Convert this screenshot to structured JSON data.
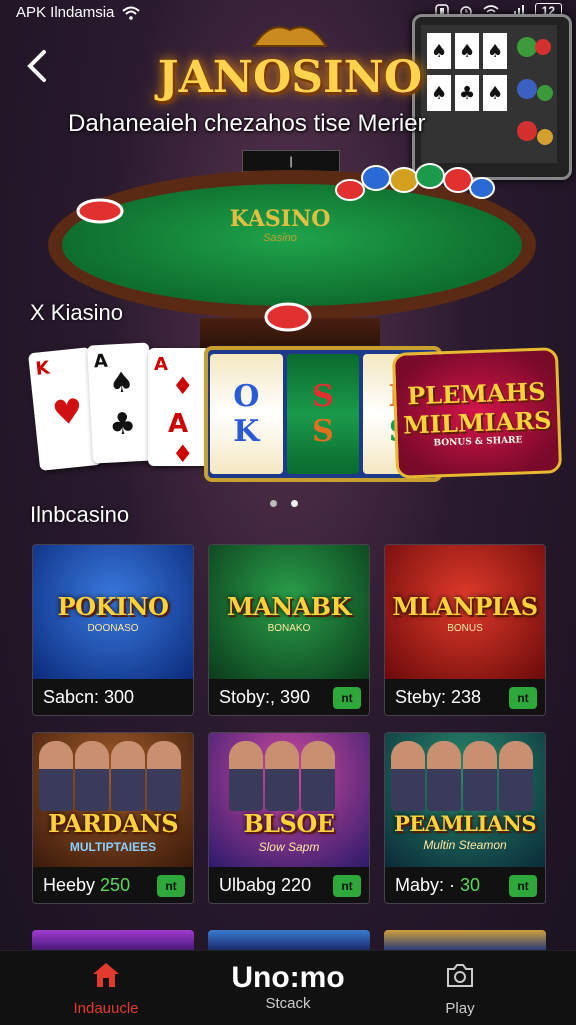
{
  "status_bar": {
    "carrier": "APK Ilndamsia",
    "battery": "12",
    "icons": [
      "wifi-icon",
      "alarm-icon",
      "signal-icon"
    ]
  },
  "header": {
    "title": "JANOSINO",
    "subtitle": "Dahaneaieh chezahos tise Merier"
  },
  "hero": {
    "table_label": "KASINO",
    "table_sub": "Sasino",
    "table_display": "|"
  },
  "sections": {
    "first": "X Kiasino",
    "second": "Ilnbcasino"
  },
  "banner": {
    "reel_symbols": [
      "O",
      "S",
      "P"
    ],
    "reel_symbols_2": [
      "K",
      "S",
      "S"
    ],
    "title_line1": "PLEMAHS",
    "title_line2": "MILMIARS",
    "title_line3": "BONUS & SHARE"
  },
  "games": [
    {
      "logo": "POKINO",
      "sublogo": "DOONASO",
      "name": "Sabcn: 300",
      "badge": ""
    },
    {
      "logo": "MANABK",
      "sublogo": "BONAKO",
      "name": "Stoby:, 390",
      "badge": "nt"
    },
    {
      "logo": "MLANPIAS",
      "sublogo": "BONUS",
      "name": "Steby: 238",
      "badge": "nt"
    },
    {
      "logo": "PARDANS",
      "sublogo": "MULTIPTAIEES",
      "name_prefix": "Heeby",
      "name_num": "250",
      "badge": "nt"
    },
    {
      "logo": "BLSOE",
      "sublogo": "Slow Sapm",
      "name": "Ulbabg 220",
      "badge": "nt"
    },
    {
      "logo": "PEAMLIANS",
      "sublogo": "Multin Steamon",
      "name_prefix": "Maby: ·",
      "name_num": "30",
      "badge": "nt"
    }
  ],
  "nav": {
    "home_label": "Indauucle",
    "brand": "Uno:mo",
    "stack_label": "Stcack",
    "play_label": "Play"
  },
  "colors": {
    "accent_red": "#e23b2e",
    "badge_green": "#2ea83a",
    "gold": "#ffd23a"
  }
}
